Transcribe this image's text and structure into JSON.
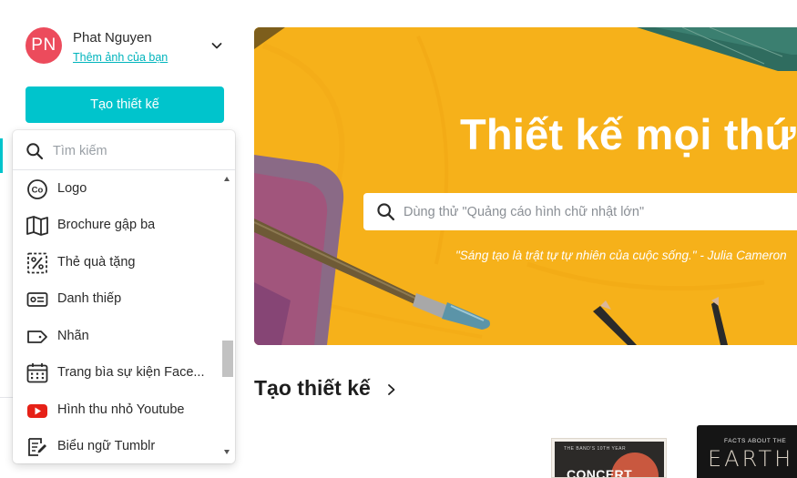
{
  "profile": {
    "initials": "PN",
    "name": "Phat Nguyen",
    "add_photo_link": "Thêm ảnh của bạn",
    "avatar_color": "#ec4b5c",
    "menu_icon": "chevron-down-icon"
  },
  "create_button": {
    "label": "Tạo thiết kế",
    "color": "#00c4cc"
  },
  "dropdown": {
    "search_placeholder": "Tìm kiếm",
    "search_icon": "search-icon",
    "items": [
      {
        "label": "Logo",
        "icon": "logo-co-icon"
      },
      {
        "label": "Brochure gập ba",
        "icon": "map-fold-icon"
      },
      {
        "label": "Thẻ quà tặng",
        "icon": "gift-card-percent-icon"
      },
      {
        "label": "Danh thiếp",
        "icon": "business-card-icon"
      },
      {
        "label": "Nhãn",
        "icon": "label-tag-icon"
      },
      {
        "label": "Trang bìa sự kiện Face...",
        "icon": "calendar-icon"
      },
      {
        "label": "Hình thu nhỏ Youtube",
        "icon": "youtube-icon"
      },
      {
        "label": "Biểu ngữ Tumblr",
        "icon": "edit-document-icon"
      }
    ]
  },
  "hero": {
    "title": "Thiết kế mọi thứ",
    "search_placeholder": "Dùng thử \"Quảng cáo hình chữ nhật lớn\"",
    "search_icon": "search-icon",
    "quote": "\"Sáng tạo là trật tự tự nhiên của cuộc sống.\" - Julia Cameron",
    "background_color": "#f8b51e"
  },
  "section": {
    "title": "Tạo thiết kế",
    "chevron_icon": "chevron-right-icon"
  },
  "templates": [
    {
      "subtitle": "THE BAND'S 10TH YEAR",
      "title": "CONCERT"
    },
    {
      "subtitle": "FACTS ABOUT THE",
      "title": "EARTH"
    }
  ]
}
